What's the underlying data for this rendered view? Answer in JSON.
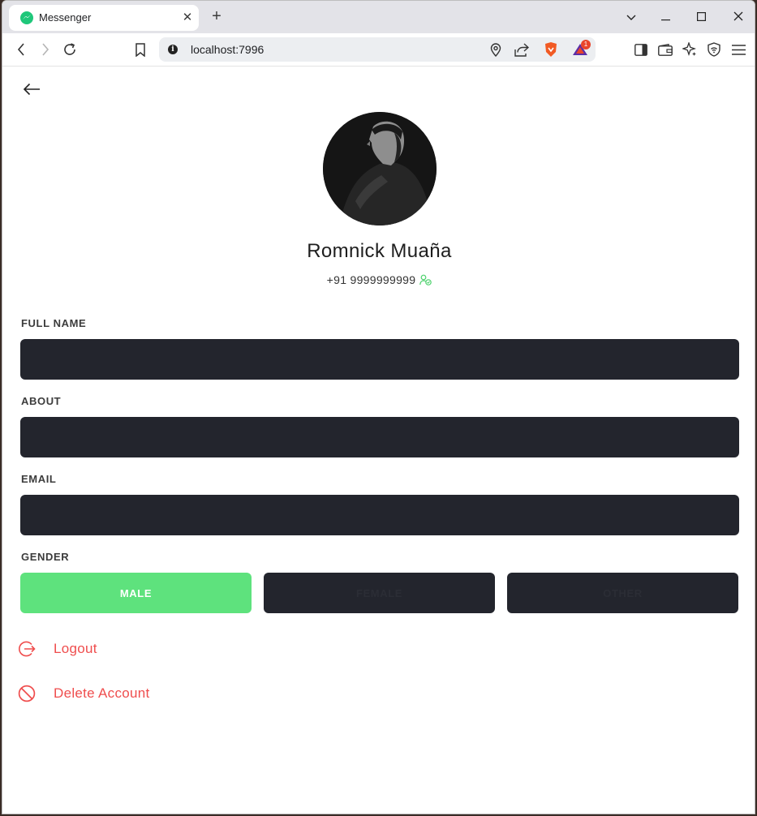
{
  "browser": {
    "tab_title": "Messenger",
    "url": "localhost:7996",
    "notification_count": "1"
  },
  "profile": {
    "name": "Romnick Muaña",
    "phone": "+91 9999999999"
  },
  "form": {
    "full_name_label": "FULL NAME",
    "full_name_value": "",
    "about_label": "ABOUT",
    "about_value": "",
    "email_label": "EMAIL",
    "email_value": "",
    "gender_label": "GENDER",
    "gender_options": [
      "MALE",
      "FEMALE",
      "OTHER"
    ],
    "gender_selected": "MALE"
  },
  "actions": {
    "logout_label": "Logout",
    "delete_label": "Delete Account"
  },
  "colors": {
    "accent_green": "#5ee27d",
    "danger_red": "#ef4d4d",
    "input_bg": "#23252d"
  },
  "icons": {
    "back": "arrow-left-icon",
    "verified": "user-check-icon",
    "logout": "logout-icon",
    "delete": "block-icon"
  }
}
